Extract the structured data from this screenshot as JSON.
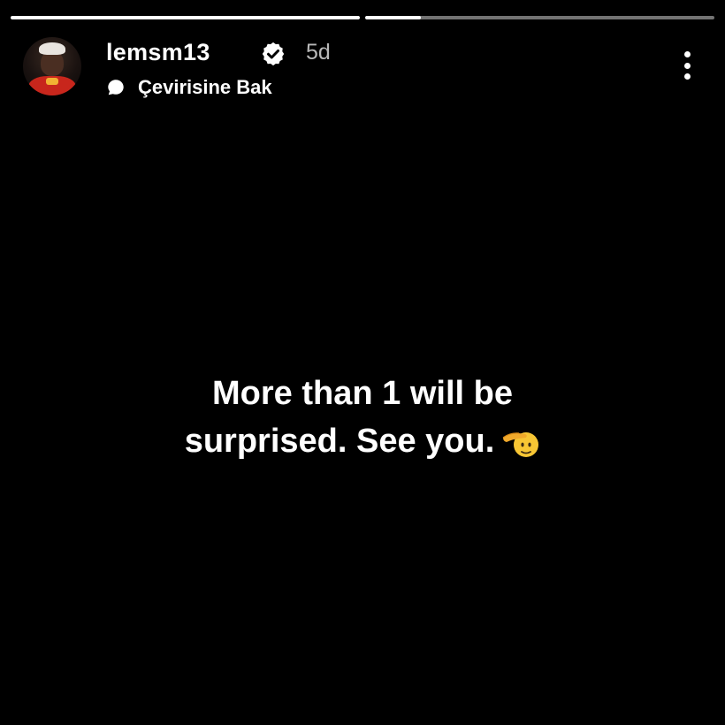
{
  "progress": {
    "segments": [
      {
        "fill": 1.0
      },
      {
        "fill": 0.16
      }
    ]
  },
  "header": {
    "username": "lemsm13",
    "time_ago": "5d",
    "translate_label": "Çevirisine Bak"
  },
  "caption": {
    "line1": "More than 1 will be",
    "line2": "surprised. See you."
  },
  "icons": {
    "verified": "verified-badge-icon",
    "translate": "speech-bubble-icon",
    "menu": "more-vertical-icon",
    "emoji": "saluting-face-emoji"
  },
  "colors": {
    "background": "#000000",
    "text": "#ffffff",
    "muted": "#b8b8b8"
  }
}
